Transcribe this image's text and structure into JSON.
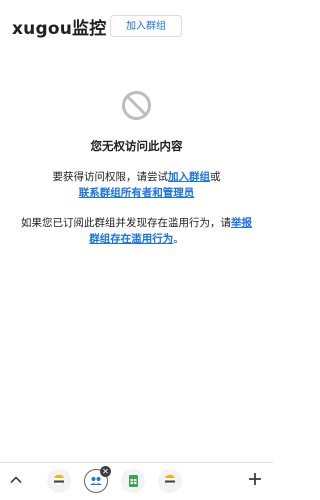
{
  "header": {
    "title": "xugou监控",
    "join_button_label": "加入群组"
  },
  "message": {
    "title": "您无权访问此内容",
    "para1_prefix": "要获得访问权限，请尝试",
    "para1_link1": "加入群组",
    "para1_or": "或",
    "para1_link2": "联系群组所有者和管理员",
    "para2_prefix": "如果您已订阅此群组并发现存在滥用行为，请",
    "para2_link": "举报群组存在滥用行为",
    "para2_suffix": "。"
  },
  "bottom_bar": {
    "tabs": [
      {
        "icon": "google-icon"
      },
      {
        "icon": "group-icon",
        "active": true
      },
      {
        "icon": "sheets-icon"
      },
      {
        "icon": "google-icon"
      }
    ]
  },
  "colors": {
    "link": "#1a73e8",
    "text": "#202124",
    "icon_gray": "#bdbdbd"
  }
}
